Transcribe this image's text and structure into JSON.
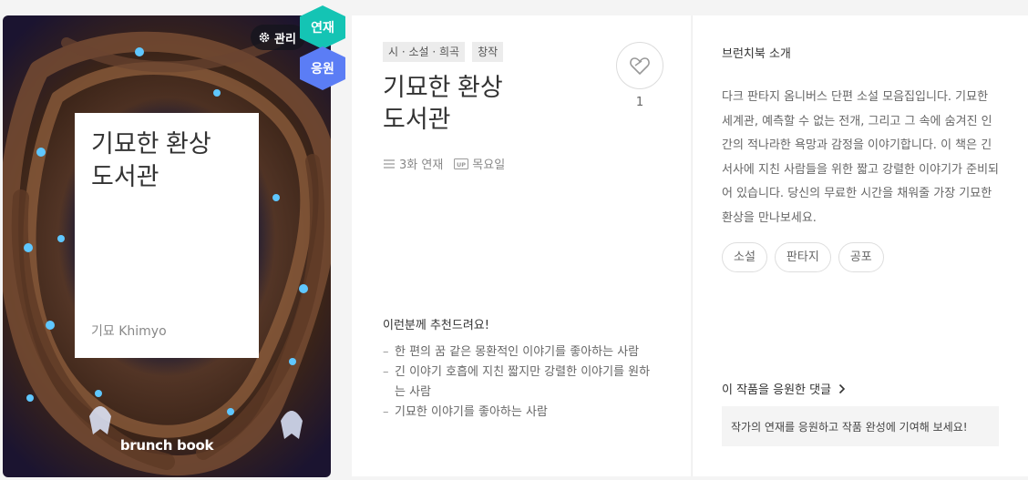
{
  "cover": {
    "badge_serial": "연재",
    "badge_support": "응원",
    "manage_label": "관리",
    "manage_icon": "gear-icon",
    "title_line1": "기묘한 환상",
    "title_line2": "도서관",
    "author": "기묘 Khimyo",
    "brand": "brunch book"
  },
  "book": {
    "tags": [
      "시 · 소설 · 희곡",
      "창작"
    ],
    "title_line1": "기묘한 환상",
    "title_line2": "도서관",
    "like_icon": "heart-outline-icon",
    "like_count": "1",
    "episodes": "3화 연재",
    "episodes_icon": "list-icon",
    "day": "목요일",
    "day_icon": "up-badge-icon"
  },
  "recommend": {
    "title": "이런분께 추천드려요!",
    "items": [
      "한 편의 꿈 같은 몽환적인 이야기를 좋아하는 사람",
      "긴 이야기 호흡에 지친 짧지만 강렬한 이야기를 원하는 사람",
      "기묘한 이야기를 좋아하는 사람"
    ]
  },
  "intro": {
    "label": "브런치북 소개",
    "text": "다크 판타지 옴니버스 단편 소설 모음집입니다. 기묘한 세계관, 예측할 수 없는 전개, 그리고 그 속에 숨겨진 인간의 적나라한 욕망과 감정을 이야기합니다. 이 책은 긴 서사에 지친 사람들을 위한 짧고 강렬한 이야기가 준비되어 있습니다. 당신의 무료한 시간을 채워줄 가장 기묘한 환상을 만나보세요.",
    "genres": [
      "소설",
      "판타지",
      "공포"
    ]
  },
  "comments": {
    "link_label": "이 작품을 응원한 댓글",
    "link_icon": "chevron-right-icon",
    "placeholder": "작가의 연재를 응원하고 작품 완성에 기여해 보세요!"
  },
  "colors": {
    "badge_serial": "#14c4b4",
    "badge_support": "#5b7df5"
  }
}
